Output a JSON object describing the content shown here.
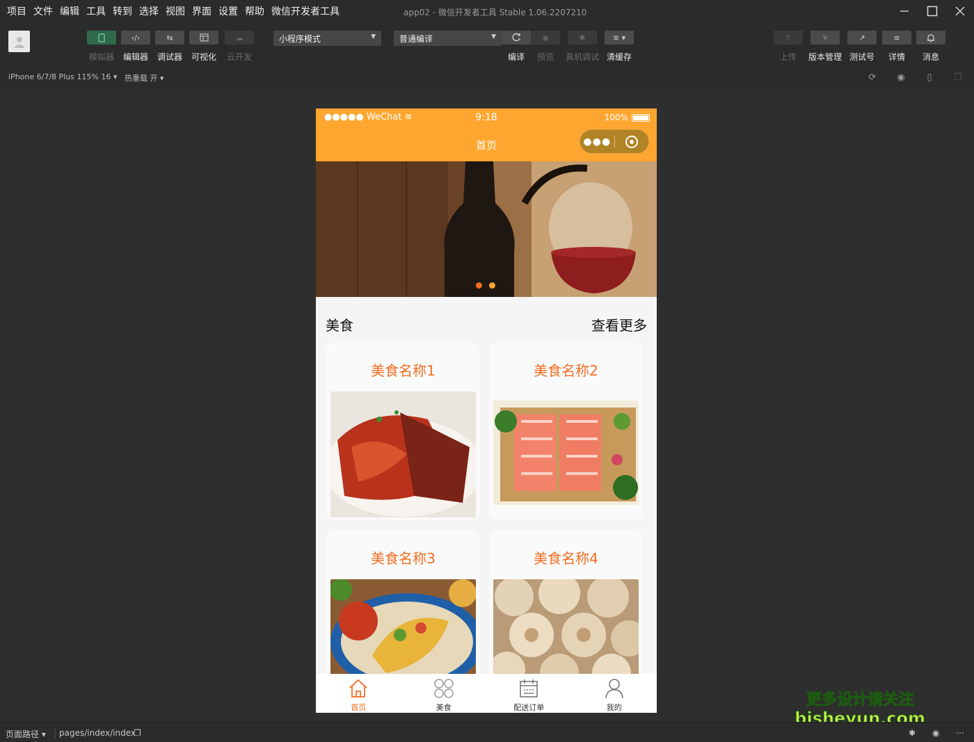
{
  "menubar": {
    "items": [
      "项目",
      "文件",
      "编辑",
      "工具",
      "转到",
      "选择",
      "视图",
      "界面",
      "设置",
      "帮助",
      "微信开发者工具"
    ],
    "window_title": "app02 - 微信开发者工具 Stable 1.06.2207210"
  },
  "toolbar": {
    "left_buttons": [
      {
        "label": "模拟器",
        "icon": "phone-icon"
      },
      {
        "label": "编辑器",
        "icon": "code-icon"
      },
      {
        "label": "调试器",
        "icon": "debug-icon"
      },
      {
        "label": "可视化",
        "icon": "layout-icon"
      },
      {
        "label": "云开发",
        "icon": "cloud-icon"
      }
    ],
    "mode_select": "小程序模式",
    "compile_select": "普通编译",
    "mid_buttons": [
      {
        "label": "编译",
        "icon": "refresh-icon"
      },
      {
        "label": "预览",
        "icon": "eye-icon"
      },
      {
        "label": "真机调试",
        "icon": "bug-icon"
      },
      {
        "label": "清缓存",
        "icon": "layers-icon"
      }
    ],
    "right_buttons": [
      {
        "label": "上传",
        "icon": "upload-icon"
      },
      {
        "label": "版本管理",
        "icon": "branch-icon"
      },
      {
        "label": "测试号",
        "icon": "external-link-icon"
      },
      {
        "label": "详情",
        "icon": "menu-icon"
      },
      {
        "label": "消息",
        "icon": "bell-icon"
      }
    ]
  },
  "subbar": {
    "device": "iPhone 6/7/8 Plus 115% 16 ▾",
    "hot_reload": "热重载 开 ▾"
  },
  "phone": {
    "status": {
      "carrier": "●●●●● WeChat",
      "time": "9:18",
      "battery": "100%"
    },
    "nav_title": "首页",
    "section": {
      "title": "美食",
      "more": "查看更多"
    },
    "cards": [
      {
        "name": "美食名称1"
      },
      {
        "name": "美食名称2"
      },
      {
        "name": "美食名称3"
      },
      {
        "name": "美食名称4"
      }
    ],
    "tabs": [
      {
        "label": "首页",
        "icon": "home-icon",
        "active": true
      },
      {
        "label": "美食",
        "icon": "grid-icon",
        "active": false
      },
      {
        "label": "配送订单",
        "icon": "calendar-icon",
        "active": false
      },
      {
        "label": "我的",
        "icon": "user-icon",
        "active": false
      }
    ],
    "colors": {
      "nav": "#ffa630",
      "accent": "#f26d21"
    }
  },
  "statusbar": {
    "path_label": "页面路径 ▾",
    "path": "pages/index/index"
  },
  "watermark": {
    "line1": "更多设计请关注",
    "line2": "bisheyun.com"
  }
}
